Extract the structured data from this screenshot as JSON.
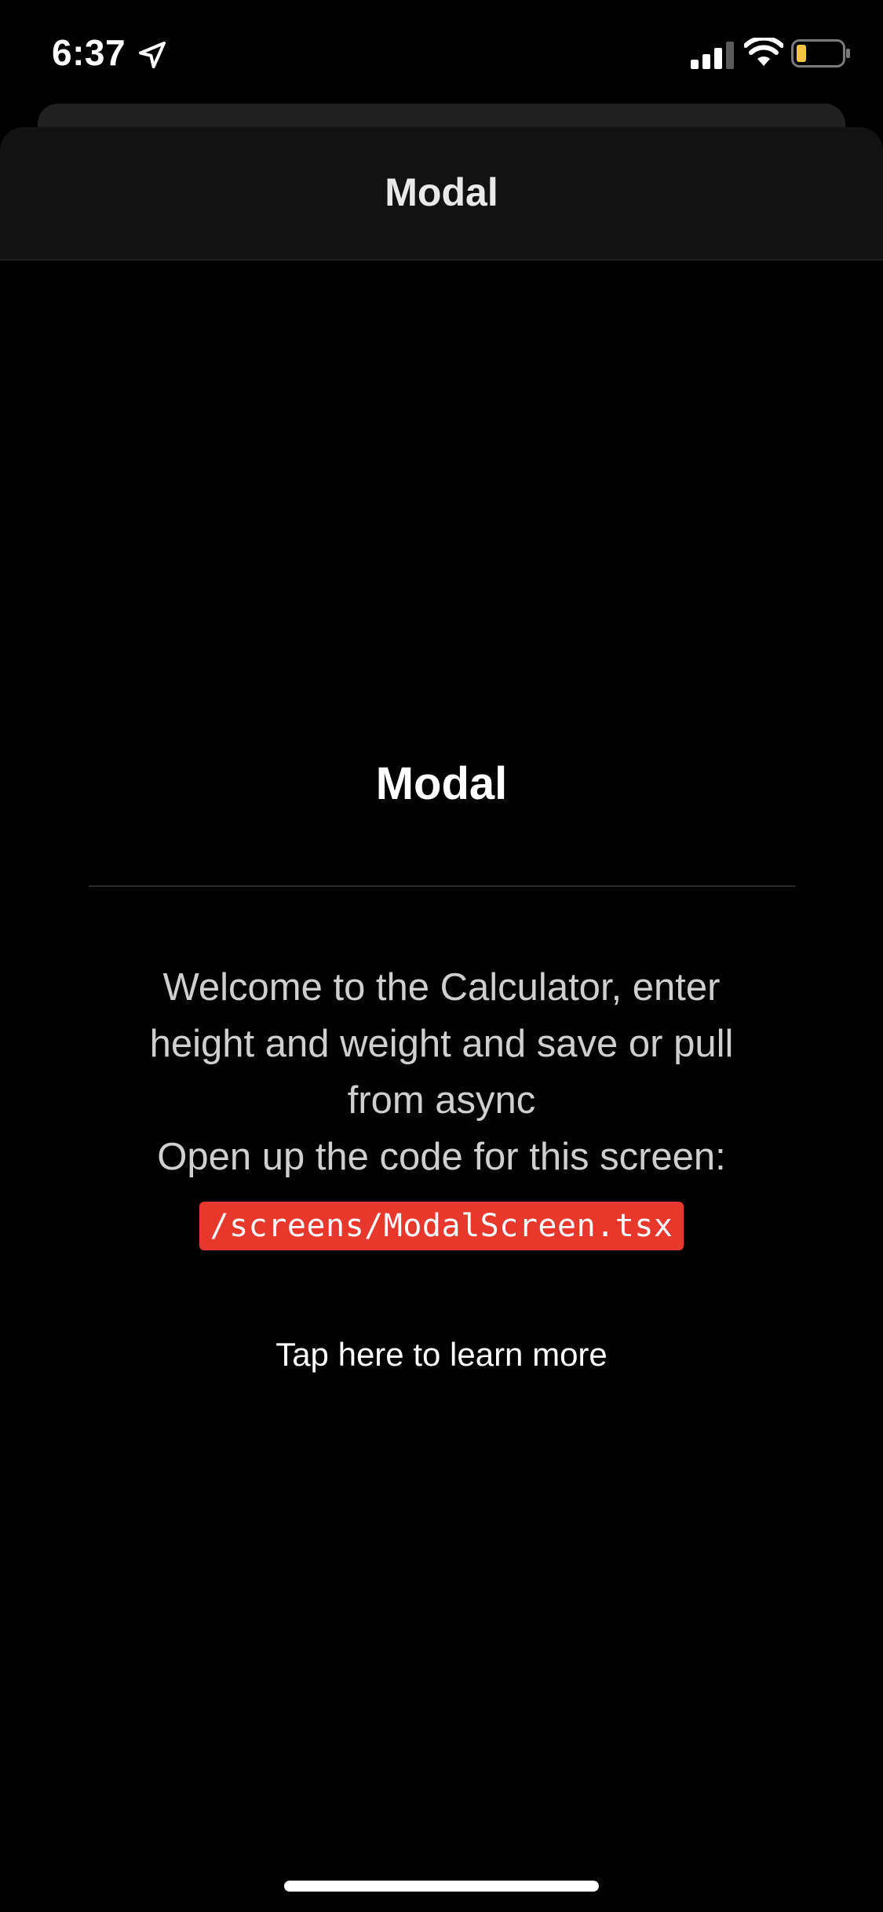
{
  "status_bar": {
    "time": "6:37",
    "icons": {
      "location": "location-arrow-icon",
      "signal": "cellular-signal-icon",
      "wifi": "wifi-icon",
      "battery": "battery-low-icon"
    },
    "battery_color": "#f4c542"
  },
  "modal": {
    "header_title": "Modal",
    "content_title": "Modal",
    "welcome_text": "Welcome to the Calculator, enter height and weight and save or pull from async",
    "open_code_text": "Open up the code for this screen:",
    "code_path": "/screens/ModalScreen.tsx",
    "learn_more": "Tap here to learn more"
  },
  "colors": {
    "background": "#000000",
    "header_background": "#121212",
    "code_highlight": "#e8372c",
    "text_primary": "#ffffff",
    "text_secondary": "#cfcfcf"
  }
}
